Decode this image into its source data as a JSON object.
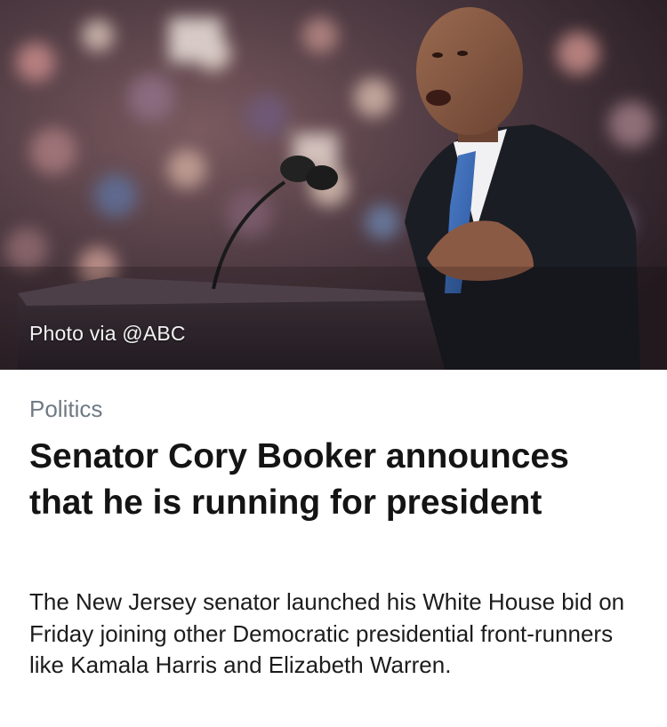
{
  "article": {
    "photo_caption": "Photo via @ABC",
    "category": "Politics",
    "headline": "Senator Cory Booker announces that he is running for president",
    "summary": "The New Jersey senator launched his White House bid on Friday joining other Democratic presidential front-runners like Kamala Harris and Elizabeth Warren."
  }
}
